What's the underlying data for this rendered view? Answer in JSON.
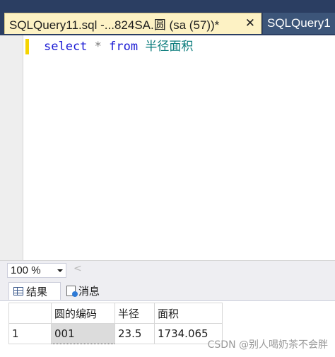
{
  "tabs": {
    "active_title": "SQLQuery11.sql -...824SA.圆 (sa (57))*",
    "active_close": "✕",
    "inactive_title": "SQLQuery1"
  },
  "editor": {
    "line1": {
      "kw_select": "select",
      "star": "*",
      "kw_from": "from",
      "table": "半径面积"
    }
  },
  "zoom": {
    "value": "100 %"
  },
  "result_tabs": {
    "results": "结果",
    "messages": "消息"
  },
  "grid": {
    "columns": [
      "圆的编码",
      "半径",
      "面积"
    ],
    "rows": [
      {
        "row_number": "1",
        "cells": [
          "001",
          "23.5",
          "1734.065"
        ]
      }
    ]
  },
  "watermark": "CSDN @别人喝奶茶不会胖",
  "colors": {
    "tab_strip": "#2b3e62",
    "active_tab": "#fdf2c4",
    "keyword": "#1a1ad4",
    "identifier": "#0b7c7c",
    "change_bar": "#f5d400"
  }
}
